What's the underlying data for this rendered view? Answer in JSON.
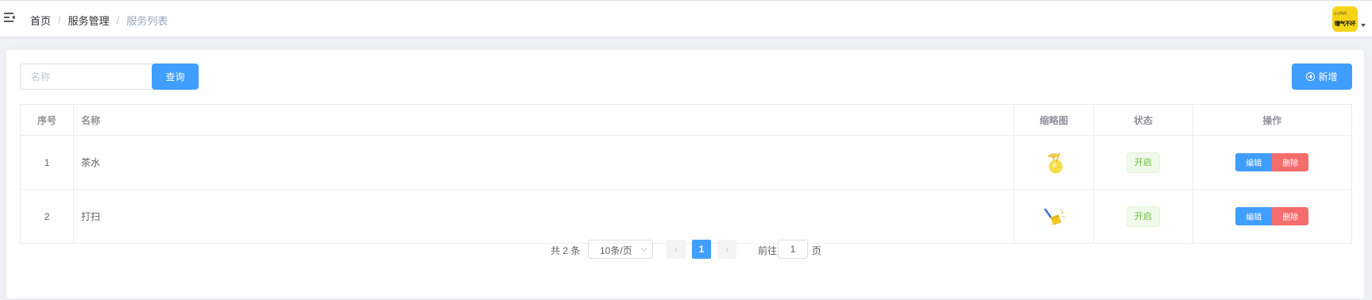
{
  "breadcrumb": [
    "首页",
    "服务管理",
    "服务列表"
  ],
  "avatar": {
    "small_text": "心之所向",
    "text": "曝气不坏",
    "color": "#f7d417"
  },
  "search": {
    "placeholder": "名称",
    "value": ""
  },
  "buttons": {
    "query": "查询",
    "add": "新增"
  },
  "table": {
    "headers": [
      "序号",
      "名称",
      "缩略图",
      "状态",
      "操作"
    ],
    "rows": [
      {
        "index": "1",
        "name": "茶水",
        "thumbnail": "drink-icon",
        "status": "开启",
        "edit": "编辑",
        "delete": "删除"
      },
      {
        "index": "2",
        "name": "打扫",
        "thumbnail": "broom-icon",
        "status": "开启",
        "edit": "编辑",
        "delete": "删除"
      }
    ]
  },
  "pagination": {
    "total": "共 2 条",
    "page_size": "10条/页",
    "prev": "‹",
    "current_page": "1",
    "next": "›",
    "goto_label": "前往",
    "goto_value": "1",
    "goto_suffix": "页"
  },
  "colors": {
    "primary": "#409eff",
    "danger": "#f56c6c",
    "success": "#67c23a"
  }
}
